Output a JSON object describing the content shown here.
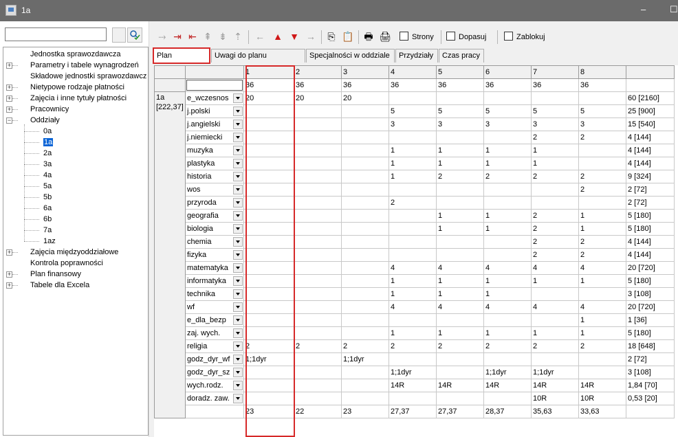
{
  "window": {
    "title": "1a",
    "minimize_glyph": "–",
    "maximize_glyph": "☐"
  },
  "search": {
    "value": "",
    "placeholder": ""
  },
  "tree": {
    "items": [
      {
        "label": "Jednostka sprawozdawcza",
        "expandable": false
      },
      {
        "label": "Parametry i tabele wynagrodzeń",
        "expandable": true
      },
      {
        "label": "Składowe jednostki sprawozdawcz",
        "expandable": false
      },
      {
        "label": "Nietypowe rodzaje płatności",
        "expandable": true
      },
      {
        "label": "Zajęcia i inne tytuły płatności",
        "expandable": true
      },
      {
        "label": "Pracownicy",
        "expandable": true
      },
      {
        "label": "Oddziały",
        "expandable": true,
        "expanded": true
      }
    ],
    "classes": [
      "0a",
      "1a",
      "2a",
      "3a",
      "4a",
      "5a",
      "5b",
      "6a",
      "6b",
      "7a",
      "1az"
    ],
    "selected_class": "1a",
    "items_after": [
      {
        "label": "Zajęcia międzyoddziałowe",
        "expandable": true
      },
      {
        "label": "Kontrola poprawności",
        "expandable": false
      },
      {
        "label": "Plan finansowy",
        "expandable": true
      },
      {
        "label": "Tabele dla Excela",
        "expandable": true
      }
    ]
  },
  "toolbar": {
    "checkboxes": [
      {
        "label": "Strony",
        "checked": false
      },
      {
        "label": "Dopasuj",
        "checked": false
      },
      {
        "label": "Zablokuj",
        "checked": false
      }
    ]
  },
  "tabs": [
    "Plan nauczania",
    "Uwagi do planu nauczania",
    "Specjalności w oddziale",
    "Przydziały",
    "Czas pracy"
  ],
  "active_tab": "Plan nauczania",
  "grid": {
    "class_label": "1a",
    "class_hours": "[222,37]",
    "columns": [
      "1",
      "2",
      "3",
      "4",
      "5",
      "6",
      "7",
      "8"
    ],
    "weeks": [
      "36",
      "36",
      "36",
      "36",
      "36",
      "36",
      "36",
      "36"
    ],
    "rows": [
      {
        "subject": "e_wczesnos",
        "values": [
          "20",
          "20",
          "20",
          "",
          "",
          "",
          "",
          ""
        ],
        "total": "60  [2160]"
      },
      {
        "subject": "j.polski",
        "values": [
          "",
          "",
          "",
          "5",
          "5",
          "5",
          "5",
          "5"
        ],
        "total": "25  [900]"
      },
      {
        "subject": "j.angielski",
        "values": [
          "",
          "",
          "",
          "3",
          "3",
          "3",
          "3",
          "3"
        ],
        "total": "15  [540]"
      },
      {
        "subject": "j.niemiecki",
        "values": [
          "",
          "",
          "",
          "",
          "",
          "",
          "2",
          "2"
        ],
        "total": "4  [144]"
      },
      {
        "subject": "muzyka",
        "values": [
          "",
          "",
          "",
          "1",
          "1",
          "1",
          "1",
          ""
        ],
        "total": "4  [144]"
      },
      {
        "subject": "plastyka",
        "values": [
          "",
          "",
          "",
          "1",
          "1",
          "1",
          "1",
          ""
        ],
        "total": "4  [144]"
      },
      {
        "subject": "historia",
        "values": [
          "",
          "",
          "",
          "1",
          "2",
          "2",
          "2",
          "2"
        ],
        "total": "9  [324]"
      },
      {
        "subject": "wos",
        "values": [
          "",
          "",
          "",
          "",
          "",
          "",
          "",
          "2"
        ],
        "total": "2  [72]"
      },
      {
        "subject": "przyroda",
        "values": [
          "",
          "",
          "",
          "2",
          "",
          "",
          "",
          ""
        ],
        "total": "2  [72]"
      },
      {
        "subject": "geografia",
        "values": [
          "",
          "",
          "",
          "",
          "1",
          "1",
          "2",
          "1"
        ],
        "total": "5  [180]"
      },
      {
        "subject": "biologia",
        "values": [
          "",
          "",
          "",
          "",
          "1",
          "1",
          "2",
          "1"
        ],
        "total": "5  [180]"
      },
      {
        "subject": "chemia",
        "values": [
          "",
          "",
          "",
          "",
          "",
          "",
          "2",
          "2"
        ],
        "total": "4  [144]"
      },
      {
        "subject": "fizyka",
        "values": [
          "",
          "",
          "",
          "",
          "",
          "",
          "2",
          "2"
        ],
        "total": "4  [144]"
      },
      {
        "subject": "matematyka",
        "values": [
          "",
          "",
          "",
          "4",
          "4",
          "4",
          "4",
          "4"
        ],
        "total": "20  [720]"
      },
      {
        "subject": "informatyka",
        "values": [
          "",
          "",
          "",
          "1",
          "1",
          "1",
          "1",
          "1"
        ],
        "total": "5  [180]"
      },
      {
        "subject": "technika",
        "values": [
          "",
          "",
          "",
          "1",
          "1",
          "1",
          "",
          ""
        ],
        "total": "3  [108]"
      },
      {
        "subject": "wf",
        "values": [
          "",
          "",
          "",
          "4",
          "4",
          "4",
          "4",
          "4"
        ],
        "total": "20  [720]"
      },
      {
        "subject": "e_dla_bezp",
        "values": [
          "",
          "",
          "",
          "",
          "",
          "",
          "",
          "1"
        ],
        "total": "1  [36]"
      },
      {
        "subject": "zaj. wych.",
        "values": [
          "",
          "",
          "",
          "1",
          "1",
          "1",
          "1",
          "1"
        ],
        "total": "5  [180]"
      },
      {
        "subject": "religia",
        "values": [
          "2",
          "2",
          "2",
          "2",
          "2",
          "2",
          "2",
          "2"
        ],
        "total": "18  [648]"
      },
      {
        "subject": "godz_dyr_wf",
        "values": [
          "1;1dyr",
          "",
          "1;1dyr",
          "",
          "",
          "",
          "",
          ""
        ],
        "total": "2  [72]"
      },
      {
        "subject": "godz_dyr_sz",
        "values": [
          "",
          "",
          "",
          "1;1dyr",
          "",
          "1;1dyr",
          "1;1dyr",
          ""
        ],
        "total": "3  [108]"
      },
      {
        "subject": "wych.rodz.",
        "values": [
          "",
          "",
          "",
          "14R",
          "14R",
          "14R",
          "14R",
          "14R"
        ],
        "total": "1,84  [70]"
      },
      {
        "subject": "doradz. zaw.",
        "values": [
          "",
          "",
          "",
          "",
          "",
          "",
          "10R",
          "10R"
        ],
        "total": "0,53  [20]"
      }
    ],
    "totals": [
      "23",
      "22",
      "23",
      "27,37",
      "27,37",
      "28,37",
      "35,63",
      "33,63"
    ]
  }
}
